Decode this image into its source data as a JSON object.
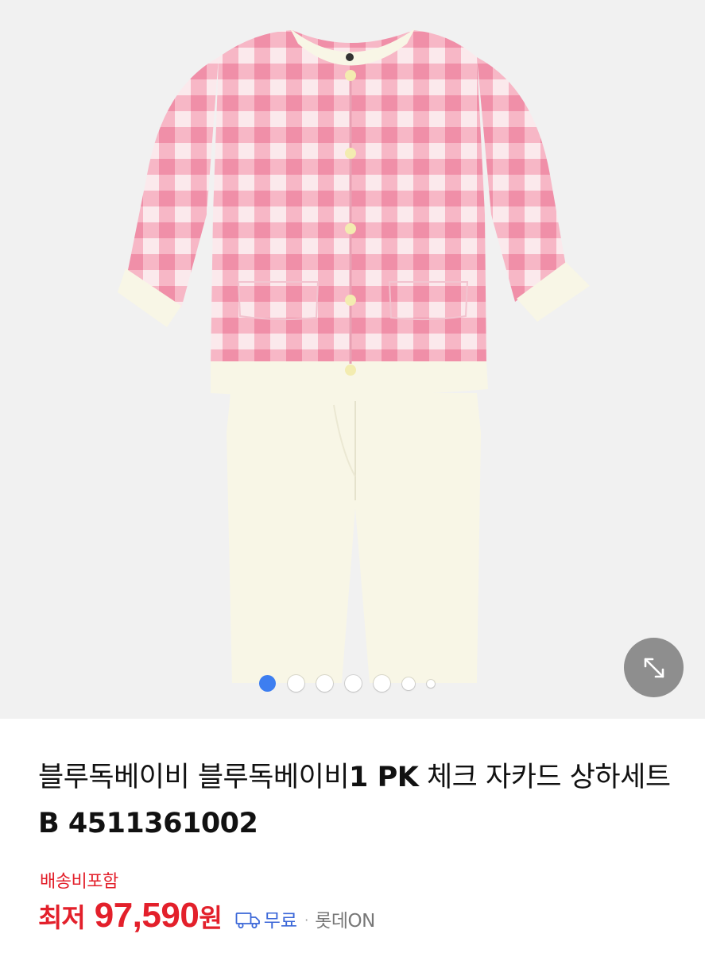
{
  "gallery": {
    "image_alt": "pink gingham check cardigan with cream trousers",
    "slide_count": 7,
    "active_slide": 1,
    "expand_icon": "expand-arrows-icon"
  },
  "product": {
    "title_part1": "블루독베이비 블루독베이비",
    "title_bold1": "1 PK",
    "title_part2": " 체크 자카드 상하세트",
    "title_bold2": "B 4511361002"
  },
  "pricing": {
    "delivery_note": "배송비포함",
    "prefix": "최저",
    "price": "97,590",
    "unit": "원",
    "shipping_icon": "truck-icon",
    "shipping": "무료",
    "separator": "·",
    "seller": "롯데ON"
  },
  "colors": {
    "price_red": "#e3202b",
    "shipping_blue": "#3b67d8",
    "active_dot": "#3d7ef0",
    "gingham_pink": "#f4a3b9",
    "cream": "#f8f6e6"
  }
}
